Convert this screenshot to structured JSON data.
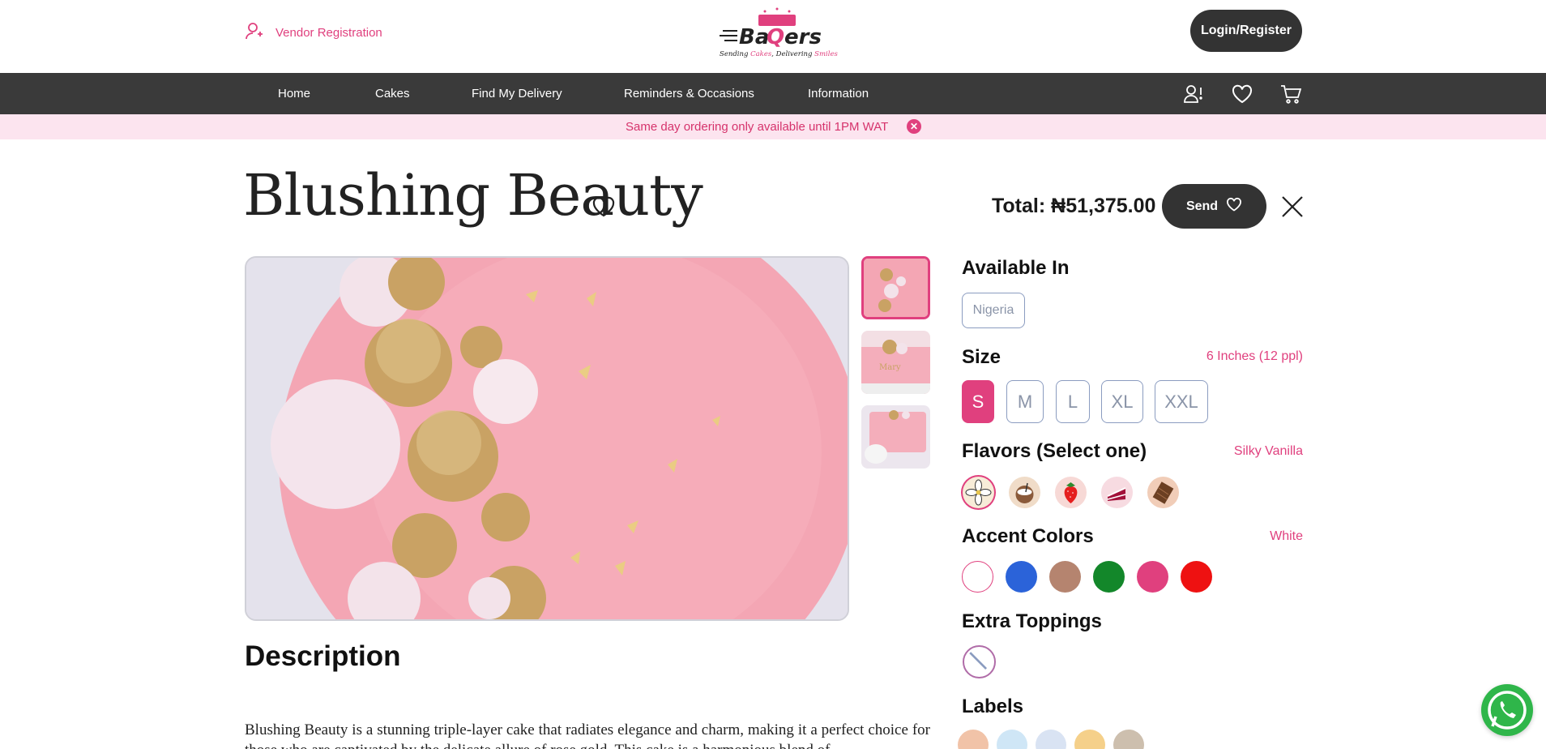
{
  "header": {
    "vendor_registration": "Vendor Registration",
    "logo_text": "BaQers",
    "logo_tagline": "Sending Cakes, Delivering Smiles",
    "login_register": "Login/Register"
  },
  "nav": {
    "items": [
      {
        "label": "Home"
      },
      {
        "label": "Cakes"
      },
      {
        "label": "Find My Delivery"
      },
      {
        "label": "Reminders & Occasions"
      },
      {
        "label": "Information"
      }
    ],
    "icons": [
      "user-alert-icon",
      "heart-icon",
      "cart-icon"
    ]
  },
  "banner": {
    "text": "Same day ordering only available until 1PM WAT",
    "close_glyph": "✕"
  },
  "product": {
    "title": "Blushing Beauty",
    "total_label": "Total:",
    "total_value": "₦51,375.00",
    "send_label": "Send"
  },
  "gallery": {
    "thumbnail_count": 3,
    "active_thumbnail": 1
  },
  "description": {
    "heading": "Description",
    "text": "Blushing Beauty is a stunning triple-layer cake that radiates elegance and charm, making it a perfect choice for those who are captivated by the delicate allure of rose gold. This cake is a harmonious blend of"
  },
  "options": {
    "available_in": {
      "title": "Available In",
      "chips": [
        "Nigeria"
      ]
    },
    "size": {
      "title": "Size",
      "selected_value": "6 Inches (12 ppl)",
      "options": [
        "S",
        "M",
        "L",
        "XL",
        "XXL"
      ],
      "selected": "S"
    },
    "flavors": {
      "title": "Flavors (Select one)",
      "selected_value": "Silky Vanilla",
      "icons": [
        "vanilla-flower-icon",
        "coconut-icon",
        "strawberry-icon",
        "red-velvet-cake-icon",
        "chocolate-icon"
      ]
    },
    "accent_colors": {
      "title": "Accent Colors",
      "selected_value": "White",
      "colors": [
        "#ffffff",
        "#2b63d9",
        "#b5846f",
        "#13872a",
        "#e0407e",
        "#ee1111"
      ]
    },
    "extra_toppings": {
      "title": "Extra Toppings",
      "icons": [
        "none-icon"
      ]
    },
    "labels": {
      "title": "Labels",
      "icons": [
        "wheat-icon",
        "milk-bottle-icon",
        "diet-icon",
        "egg-icon",
        "nut-icon"
      ]
    }
  },
  "colors": {
    "accent": "#e0407e",
    "dark": "#333333",
    "banner_bg": "#fce4ef"
  }
}
